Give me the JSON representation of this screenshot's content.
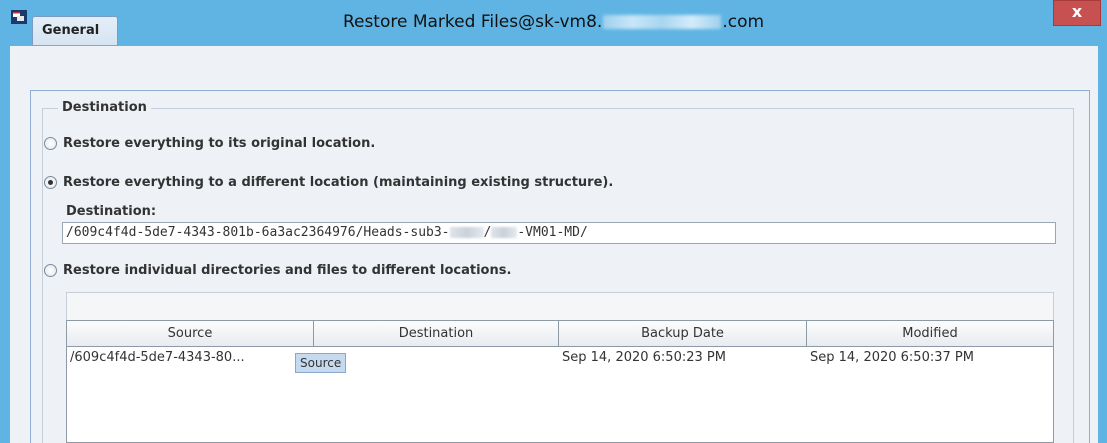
{
  "window": {
    "title_prefix": "Restore Marked Files@sk-vm8.",
    "title_suffix": ".com",
    "close_label": "x"
  },
  "tabs": [
    {
      "label": "General"
    }
  ],
  "destination_group": {
    "title": "Destination",
    "option_original": "Restore everything to its original location.",
    "option_different": "Restore everything to a different location (maintaining existing structure).",
    "option_individual": "Restore individual directories and files to different locations.",
    "selected": "option_different",
    "destination_label": "Destination:",
    "destination_value_start": "/609c4f4d-5de7-4343-801b-6a3ac2364976/Heads-sub3-",
    "destination_value_mid": "/",
    "destination_value_end": "-VM01-MD/"
  },
  "table": {
    "columns": [
      "Source",
      "Destination",
      "Backup Date",
      "Modified"
    ],
    "rows": [
      {
        "source": "/609c4f4d-5de7-4343-80...",
        "destination": "",
        "backup_date": "Sep 14, 2020 6:50:23 PM",
        "modified": "Sep 14, 2020 6:50:37 PM"
      }
    ],
    "tooltip": "Source"
  }
}
